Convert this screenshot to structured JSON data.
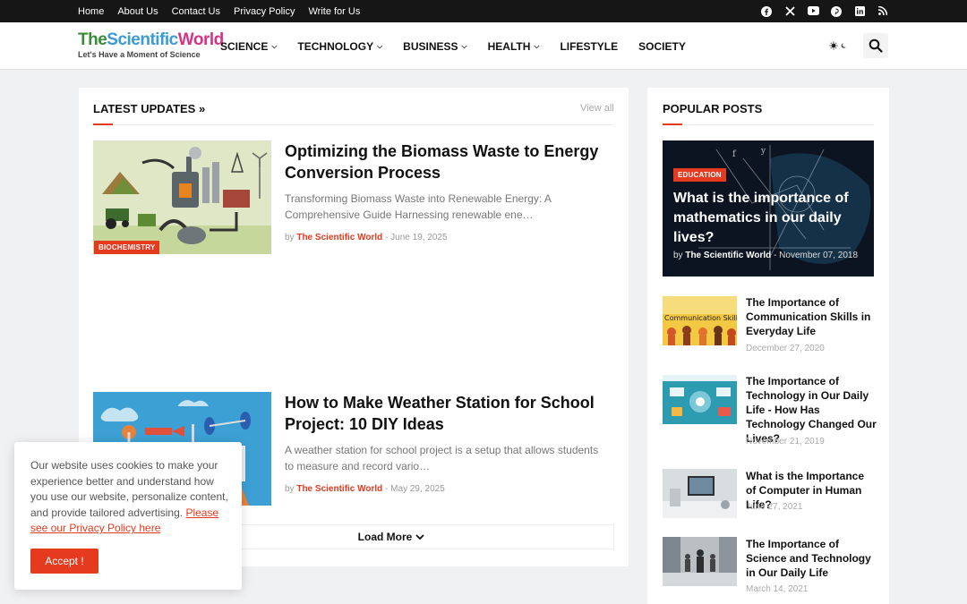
{
  "topnav": {
    "links": [
      "Home",
      "About Us",
      "Contact Us",
      "Privacy Policy",
      "Write for Us"
    ]
  },
  "social": {
    "icons": [
      "facebook-icon",
      "x-icon",
      "youtube-icon",
      "pinterest-icon",
      "linkedin-icon",
      "rss-icon"
    ]
  },
  "logo": {
    "line1_a": "The",
    "line1_b": "Scientific",
    "line1_c": "World",
    "tagline": "Let's Have a Moment of Science"
  },
  "mainnav": {
    "items": [
      "SCIENCE",
      "TECHNOLOGY",
      "BUSINESS",
      "HEALTH",
      "LIFESTYLE",
      "SOCIETY"
    ]
  },
  "latest": {
    "title": "LATEST UPDATES »",
    "view_all": "View all",
    "posts": [
      {
        "title": "Optimizing the Biomass Waste to Energy Conversion Process",
        "snippet": "Transforming Biomass Waste into Renewable Energy: A Comprehensive Guide Harnessing renewable ene…",
        "by": "by",
        "author": "The Scientific World",
        "date": "- June 19, 2025",
        "badge": "BIOCHEMISTRY"
      },
      {
        "title": "How to Make Weather Station for School Project: 10 DIY Ideas",
        "snippet": "A weather station for school project is a setup that allows students to measure and record vario…",
        "by": "by",
        "author": "The Scientific World",
        "date": "- May 29, 2025"
      }
    ],
    "load_more": "Load More"
  },
  "popular": {
    "title": "POPULAR POSTS",
    "feature": {
      "badge": "EDUCATION",
      "title": "What is the importance of mathematics in our daily lives?",
      "by": "by",
      "author": "The Scientific World",
      "date": "- November 07, 2018"
    },
    "items": [
      {
        "title": "The Importance of Communication Skills in Everyday Life",
        "date": "December 27, 2020",
        "thumb_text": "Communication Skills"
      },
      {
        "title": "The Importance of Technology in Our Daily Life - How Has Technology Changed Our Lives?",
        "date": "November 21, 2019"
      },
      {
        "title": "What is the Importance of Computer in Human Life?",
        "date": "June 27, 2021"
      },
      {
        "title": "The Importance of Science and Technology in Our Daily Life",
        "date": "March 14, 2021"
      }
    ]
  },
  "cookie": {
    "text": "Our website uses cookies to make your experience better and understand how you use our website, personalize content, and provide tailored advertising. ",
    "link": "Please see our Privacy Policy here",
    "accept": "Accept !"
  },
  "colors": {
    "accent": "#e63a1e",
    "topbar": "#161617"
  }
}
